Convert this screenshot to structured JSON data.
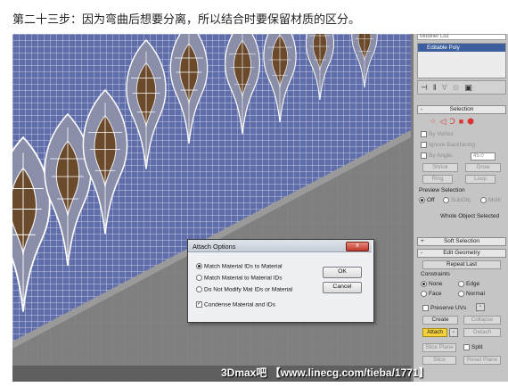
{
  "caption": "第二十三步：因为弯曲后想要分离，所以结合时要保留材质的区分。",
  "command_panel": {
    "modifier_list": "Modifier List",
    "stack_item": "Editable Poly",
    "selection": {
      "title": "Selection",
      "by_vertex": "By Vertex",
      "ignore_backfacing": "Ignore Backfacing",
      "by_angle": "By Angle:",
      "by_angle_value": "45.0",
      "shrink": "Shrink",
      "grow": "Grow",
      "ring": "Ring",
      "loop": "Loop",
      "preview_title": "Preview Selection",
      "preview_off": "Off",
      "preview_subobj": "SubObj",
      "preview_multi": "Multi",
      "status": "Whole Object Selected"
    },
    "soft_selection": "Soft Selection",
    "edit_geometry": {
      "title": "Edit Geometry",
      "repeat_last": "Repeat Last",
      "constraints": "Constraints",
      "none": "None",
      "edge": "Edge",
      "face": "Face",
      "normal": "Normal",
      "preserve_uvs": "Preserve UVs",
      "create": "Create",
      "collapse": "Collapse",
      "attach": "Attach",
      "detach": "Detach",
      "slice_plane": "Slice Plane",
      "split": "Split",
      "slice": "Slice",
      "reset_plane": "Reset Plane"
    }
  },
  "dialog": {
    "title": "Attach Options",
    "close_label": "x",
    "options": [
      "Match Material IDs to Material",
      "Match Material to Material IDs",
      "Do Not Modify Mat IDs or Material"
    ],
    "selected_option": 0,
    "condense": "Condense Material and IDs",
    "ok": "OK",
    "cancel": "Cancel"
  },
  "watermark": "3Dmax吧 【www.linecg.com/tieba/1771】"
}
